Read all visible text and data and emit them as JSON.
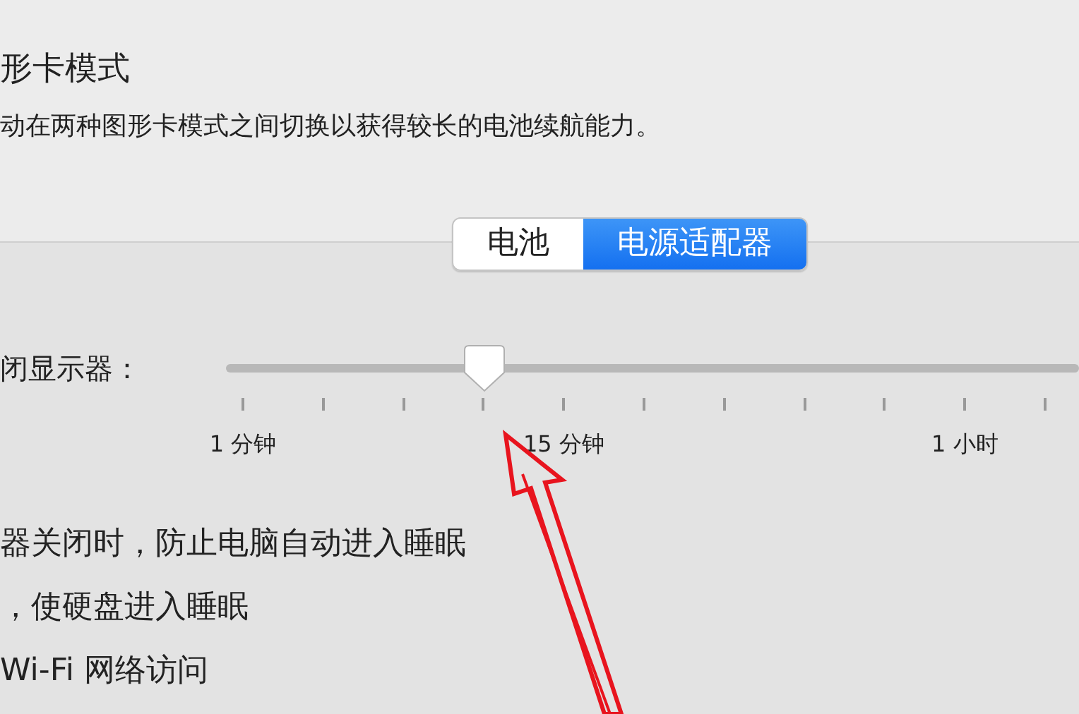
{
  "graphics_switching": {
    "title": "形卡模式",
    "description": "动在两种图形卡模式之间切换以获得较长的电池续航能力。"
  },
  "tabs": [
    {
      "label": "电池",
      "selected": false
    },
    {
      "label": "电源适配器",
      "selected": true
    }
  ],
  "display_sleep": {
    "label": "闭显示器：",
    "level": 0.303,
    "ticks": [
      {
        "kind": "labeled",
        "label": "1 分钟"
      },
      {
        "kind": "plain"
      },
      {
        "kind": "plain"
      },
      {
        "kind": "plain"
      },
      {
        "kind": "labeled",
        "label": "15 分钟"
      },
      {
        "kind": "plain"
      },
      {
        "kind": "plain"
      },
      {
        "kind": "plain"
      },
      {
        "kind": "plain"
      },
      {
        "kind": "labeled",
        "label": "1 小时"
      },
      {
        "kind": "plain"
      }
    ]
  },
  "options": [
    "器关闭时，防止电脑自动进入睡眠",
    "，使硬盘进入睡眠",
    "Wi-Fi 网络访问"
  ]
}
